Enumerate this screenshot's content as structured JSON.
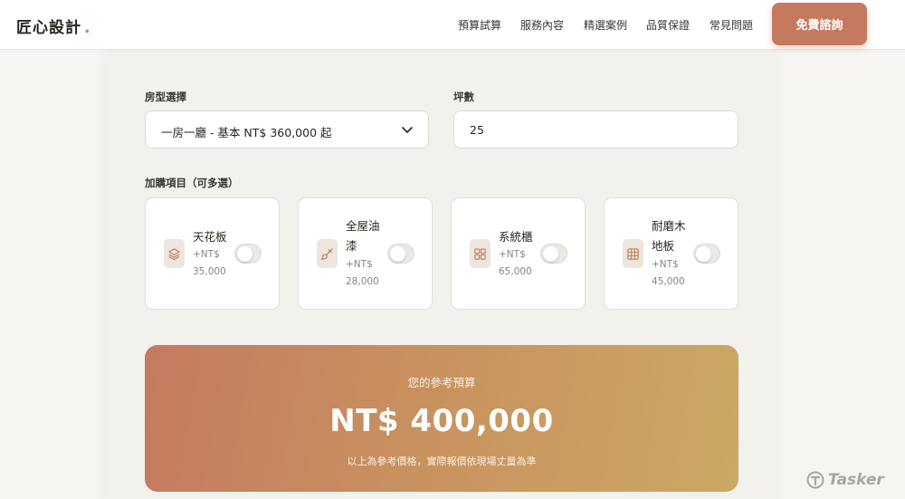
{
  "header": {
    "logo": "匠心設計",
    "logo_dot": ".",
    "nav": [
      "預算試算",
      "服務內容",
      "精選案例",
      "品質保證",
      "常見問題"
    ],
    "cta": "免費諮詢"
  },
  "form": {
    "room_type_label": "房型選擇",
    "room_type_value": "一房一廳 - 基本 NT$ 360,000 起",
    "area_label": "坪數",
    "area_value": "25",
    "addons_label": "加購項目（可多選）"
  },
  "addons": [
    {
      "name_lines": [
        "天花板"
      ],
      "price_lines": [
        "+NT$",
        "35,000"
      ],
      "icon": "layers-icon",
      "enabled": false
    },
    {
      "name_lines": [
        "全屋油",
        "漆"
      ],
      "price_lines": [
        "+NT$",
        "28,000"
      ],
      "icon": "paint-brush-icon",
      "enabled": false
    },
    {
      "name_lines": [
        "系統櫃"
      ],
      "price_lines": [
        "+NT$",
        "65,000"
      ],
      "icon": "grid-icon",
      "enabled": false
    },
    {
      "name_lines": [
        "耐磨木",
        "地板"
      ],
      "price_lines": [
        "+NT$",
        "45,000"
      ],
      "icon": "floor-grid-icon",
      "enabled": false
    }
  ],
  "result": {
    "label": "您的參考預算",
    "amount": "NT$ 400,000",
    "note": "以上為參考價格，實際報價依現場丈量為準"
  },
  "watermark": "Tasker",
  "colors": {
    "accent": "#c57a60",
    "gradient_end": "#cba863",
    "icon_stroke": "#c57a60"
  }
}
